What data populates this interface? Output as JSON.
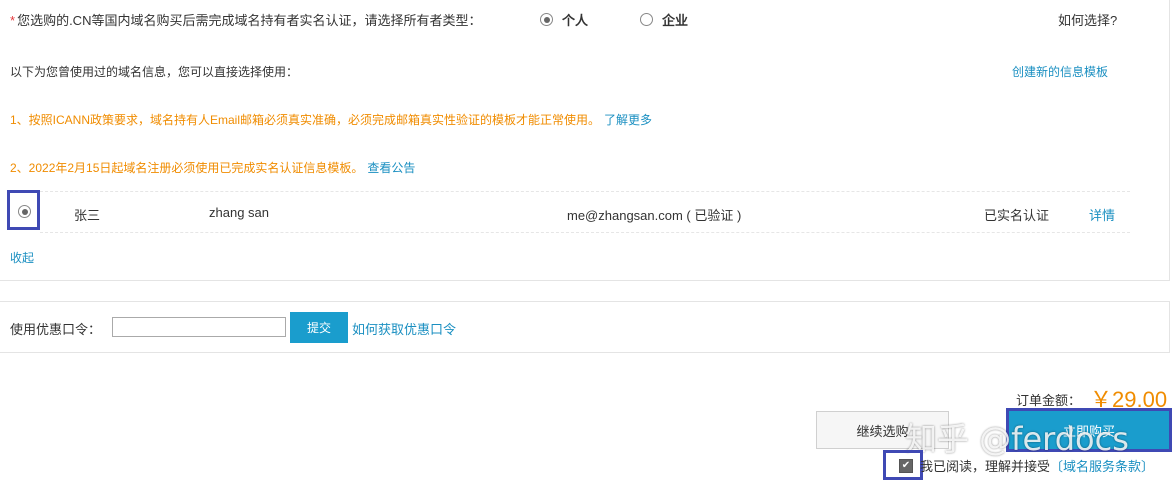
{
  "owner_type": {
    "required_star": "*",
    "prompt": "您选购的.CN等国内域名购买后需完成域名持有者实名认证，请选择所有者类型：",
    "options": [
      {
        "label": "个人",
        "selected": true
      },
      {
        "label": "企业",
        "selected": false
      }
    ],
    "help_link": "如何选择?"
  },
  "used_info": {
    "text": "以下为您曾使用过的域名信息，您可以直接选择使用：",
    "create_link": "创建新的信息模板"
  },
  "notes": [
    {
      "text": "1、按照ICANN政策要求，域名持有人Email邮箱必须真实准确，必须完成邮箱真实性验证的模板才能正常使用。",
      "link": "了解更多"
    },
    {
      "text": "2、2022年2月15日起域名注册必须使用已完成实名认证信息模板。",
      "link": "查看公告"
    }
  ],
  "contact": {
    "selected": true,
    "name_cn": "张三",
    "name_en": "zhang san",
    "email": "me@zhangsan.com ( 已验证 )",
    "status": "已实名认证",
    "detail_link": "详情"
  },
  "collapse_label": "收起",
  "coupon": {
    "label": "使用优惠口令：",
    "value": "",
    "submit_label": "提交",
    "help_link": "如何获取优惠口令"
  },
  "order": {
    "amount_label": "订单金额：",
    "amount_value": "￥29.00",
    "continue_label": "继续选购",
    "pay_label": "立即购买",
    "watermark": "知乎 @ferdocs"
  },
  "agreement": {
    "checked": true,
    "text": "我已阅读，理解并接受",
    "terms_link": "〔域名服务条款〕"
  },
  "colors": {
    "accent": "#1a9dcd",
    "link": "#1a8fc1",
    "warning": "#f08c00",
    "highlight": "#3f49b4"
  }
}
